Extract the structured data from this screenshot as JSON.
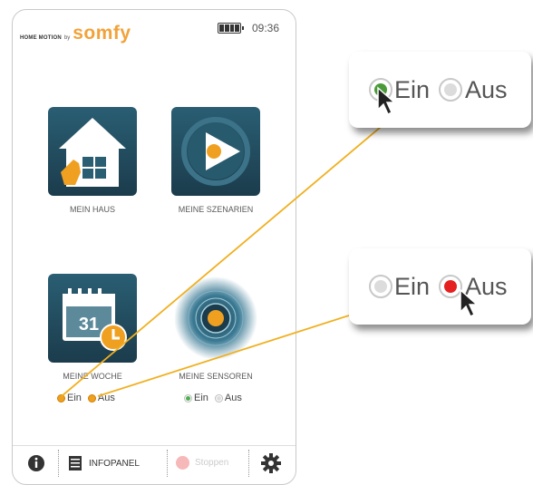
{
  "header": {
    "brand_prefix": "HOME MOTION",
    "brand_by": "by",
    "brand_logo": "somfy",
    "battery_icon": "battery-icon",
    "time": "09:36"
  },
  "tiles": [
    {
      "label": "MEIN HAUS",
      "icon": "house-icon"
    },
    {
      "label": "MEINE SZENARIEN",
      "icon": "play-icon"
    },
    {
      "label": "MEINE WOCHE",
      "icon": "calendar-icon",
      "calendar_day": "31"
    },
    {
      "label": "MEINE SENSOREN",
      "icon": "sensor-icon"
    }
  ],
  "radios": {
    "woche": {
      "on": "Ein",
      "off": "Aus"
    },
    "sensoren": {
      "on": "Ein",
      "off": "Aus"
    }
  },
  "bottom_bar": {
    "info_icon": "info-icon",
    "infopanel_label": "INFOPANEL",
    "stop_label": "Stoppen",
    "settings_icon": "gear-icon"
  },
  "callouts": {
    "top": {
      "on": "Ein",
      "off": "Aus",
      "selected": "Ein"
    },
    "bottom": {
      "on": "Ein",
      "off": "Aus",
      "selected": "Aus"
    }
  },
  "colors": {
    "accent": "#f2a23a",
    "tile_dark": "#1b3c4c",
    "connector": "#f0b020",
    "selected_green": "#4a9a3a",
    "selected_red": "#e52020"
  }
}
